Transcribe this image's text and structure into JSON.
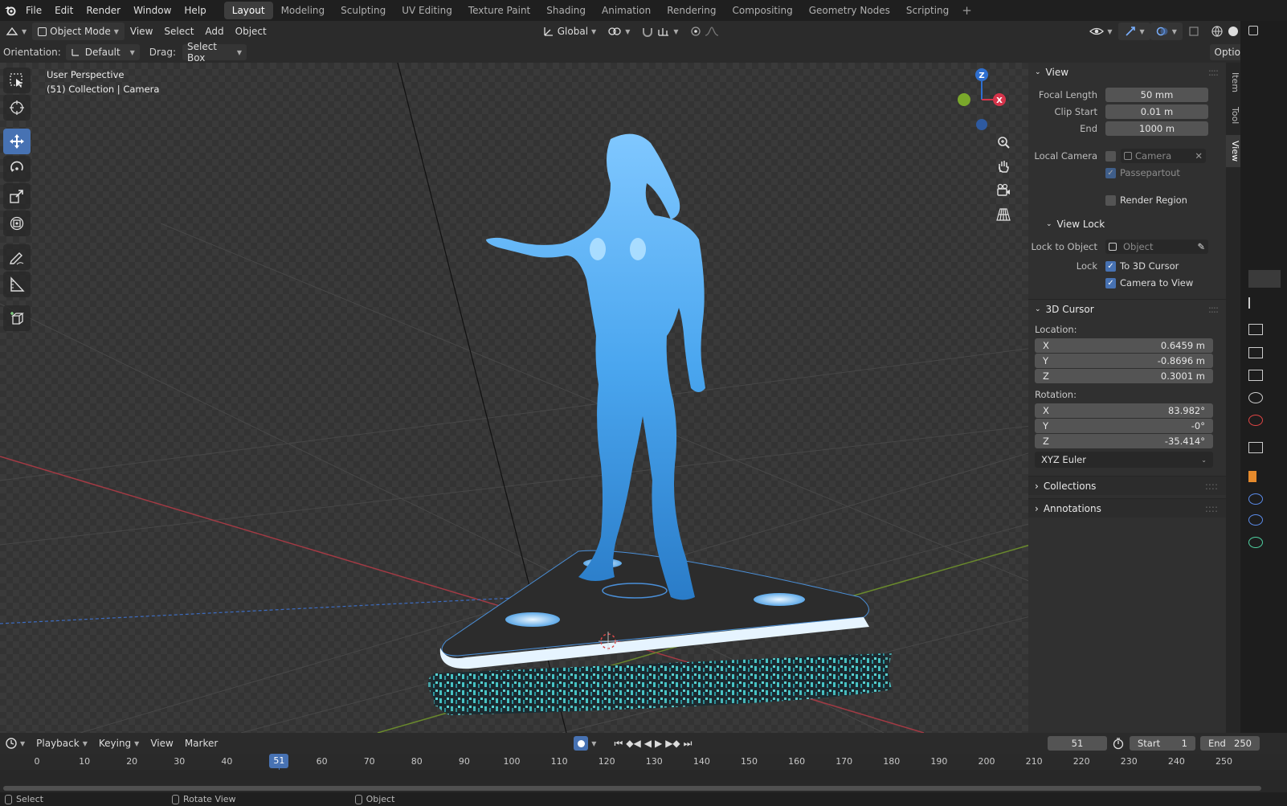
{
  "app": {
    "menu": [
      "File",
      "Edit",
      "Render",
      "Window",
      "Help"
    ],
    "workspaces": [
      "Layout",
      "Modeling",
      "Sculpting",
      "UV Editing",
      "Texture Paint",
      "Shading",
      "Animation",
      "Rendering",
      "Compositing",
      "Geometry Nodes",
      "Scripting"
    ],
    "active_workspace": "Layout"
  },
  "header": {
    "mode": "Object Mode",
    "menus": [
      "View",
      "Select",
      "Add",
      "Object"
    ],
    "transform_orientation": "Global",
    "options_label": "Options"
  },
  "tool_settings": {
    "orientation_label": "Orientation:",
    "orientation_value": "Default",
    "drag_label": "Drag:",
    "drag_value": "Select Box"
  },
  "viewport": {
    "view_name": "User Perspective",
    "collection_info": "(51) Collection | Camera",
    "gizmo_axes": {
      "z": "Z",
      "x": "X"
    }
  },
  "npanel": {
    "tabs": [
      "Item",
      "Tool",
      "View"
    ],
    "active_tab": "View",
    "view": {
      "title": "View",
      "focal_length_label": "Focal Length",
      "focal_length": "50 mm",
      "clip_start_label": "Clip Start",
      "clip_start": "0.01 m",
      "clip_end_label": "End",
      "clip_end": "1000 m",
      "local_camera_label": "Local Camera",
      "local_camera_placeholder": "Camera",
      "passepartout_label": "Passepartout",
      "render_region_label": "Render Region"
    },
    "view_lock": {
      "title": "View Lock",
      "lock_to_object_label": "Lock to Object",
      "lock_to_object_placeholder": "Object",
      "lock_label": "Lock",
      "to_3d_cursor_label": "To 3D Cursor",
      "camera_to_view_label": "Camera to View"
    },
    "cursor": {
      "title": "3D Cursor",
      "location_label": "Location:",
      "location": [
        {
          "axis": "X",
          "value": "0.6459 m"
        },
        {
          "axis": "Y",
          "value": "-0.8696 m"
        },
        {
          "axis": "Z",
          "value": "0.3001 m"
        }
      ],
      "rotation_label": "Rotation:",
      "rotation": [
        {
          "axis": "X",
          "value": "83.982°"
        },
        {
          "axis": "Y",
          "value": "-0°"
        },
        {
          "axis": "Z",
          "value": "-35.414°"
        }
      ],
      "rotation_mode": "XYZ Euler"
    },
    "collections_title": "Collections",
    "annotations_title": "Annotations"
  },
  "timeline": {
    "menus": [
      "Playback",
      "Keying",
      "View",
      "Marker"
    ],
    "current_frame": "51",
    "start_label": "Start",
    "start": "1",
    "end_label": "End",
    "end": "250",
    "ticks": [
      "0",
      "10",
      "20",
      "30",
      "40",
      "50",
      "60",
      "70",
      "80",
      "90",
      "100",
      "110",
      "120",
      "130",
      "140",
      "150",
      "160",
      "170",
      "180",
      "190",
      "200",
      "210",
      "220",
      "230",
      "240",
      "250"
    ]
  },
  "statusbar": {
    "select": "Select",
    "rotate_view": "Rotate View",
    "object": "Object"
  },
  "colors": {
    "accent": "#4772b3",
    "hologram": "#5ab4ff",
    "axis_x": "#d6344b",
    "axis_y": "#7aa82b",
    "axis_z": "#2e6fd0"
  }
}
